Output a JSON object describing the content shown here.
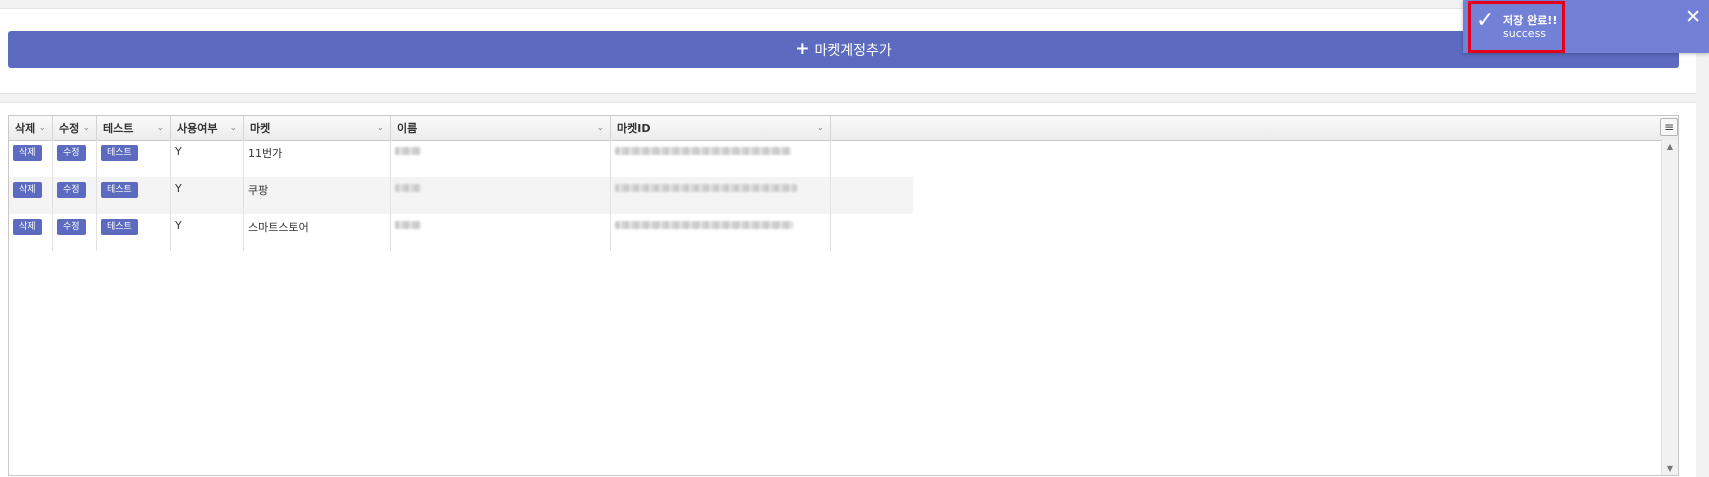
{
  "toolbar": {
    "add_label": "마켓계정추가"
  },
  "grid": {
    "columns": [
      {
        "label": "삭제"
      },
      {
        "label": "수정"
      },
      {
        "label": "테스트"
      },
      {
        "label": "사용여부"
      },
      {
        "label": "마켓"
      },
      {
        "label": "이름"
      },
      {
        "label": "마켓ID"
      }
    ],
    "rows": [
      {
        "delete": "삭제",
        "edit": "수정",
        "test": "테스트",
        "use": "Y",
        "market": "11번가"
      },
      {
        "delete": "삭제",
        "edit": "수정",
        "test": "테스트",
        "use": "Y",
        "market": "쿠팡"
      },
      {
        "delete": "삭제",
        "edit": "수정",
        "test": "테스트",
        "use": "Y",
        "market": "스마트스토어"
      }
    ]
  },
  "toast": {
    "title": "저장 완료!!",
    "message": "success"
  }
}
